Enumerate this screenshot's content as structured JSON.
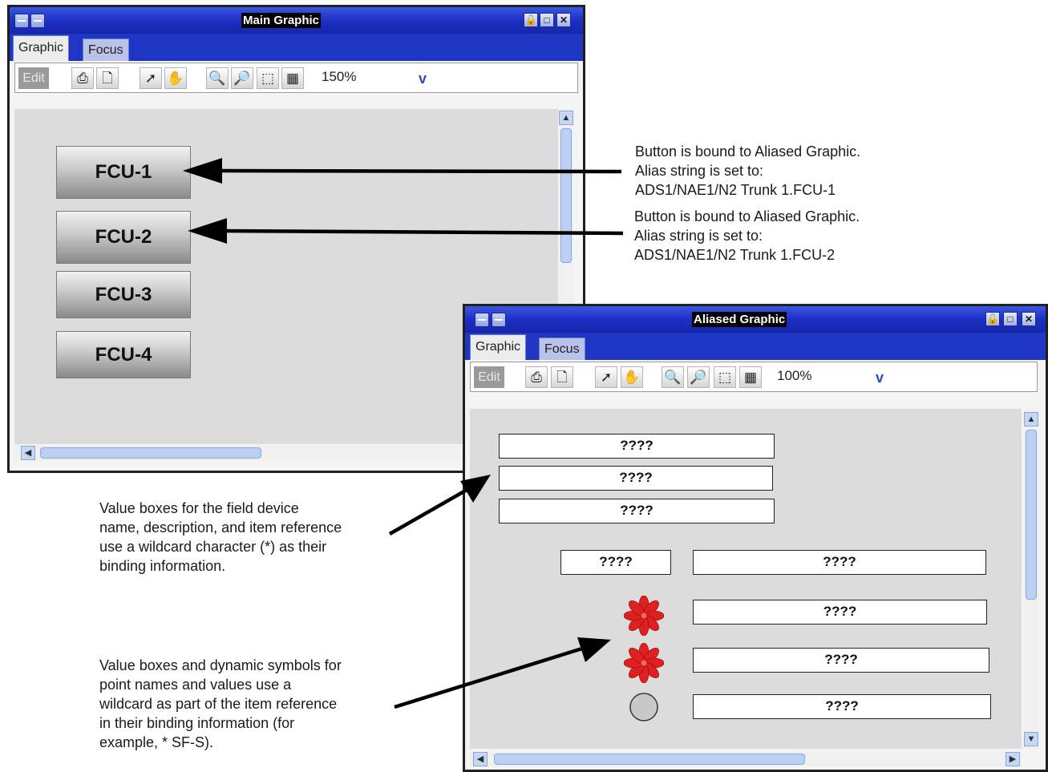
{
  "main_window": {
    "title": "Main Graphic",
    "tabs": [
      "Graphic",
      "Focus"
    ],
    "toolbar": {
      "edit_label": "Edit",
      "zoom": "150%",
      "zoom_dropdown_glyph": "v"
    },
    "buttons": [
      "FCU-1",
      "FCU-2",
      "FCU-3",
      "FCU-4"
    ]
  },
  "aliased_window": {
    "title": "Aliased Graphic",
    "tabs": [
      "Graphic",
      "Focus"
    ],
    "toolbar": {
      "edit_label": "Edit",
      "zoom": "100%",
      "zoom_dropdown_glyph": "v"
    },
    "value_boxes": [
      "????",
      "????",
      "????",
      "????",
      "????",
      "????",
      "????",
      "????"
    ],
    "symbols": [
      {
        "name": "fan-symbol",
        "color": "#e02020"
      },
      {
        "name": "fan-symbol",
        "color": "#e02020"
      },
      {
        "name": "status-circle",
        "color": "#c8c8c8"
      }
    ]
  },
  "annotations": {
    "fcu1": "Button is bound to Aliased Graphic.\nAlias string is set to:\nADS1/NAE1/N2 Trunk 1.FCU-1",
    "fcu2": "Button is bound to Aliased Graphic.\nAlias string is set to:\nADS1/NAE1/N2 Trunk 1.FCU-2",
    "value_boxes": "Value boxes for the field device\nname, description, and item reference\nuse a wildcard character (*) as their\nbinding information.",
    "symbols": "Value boxes and dynamic symbols for\npoint names and values use a\nwildcard as part of the item reference\nin their binding information (for\nexample, * SF-S)."
  },
  "colors": {
    "titlebar": "#1d2fc6",
    "canvas": "#dcdcdc",
    "fan": "#e02020"
  }
}
